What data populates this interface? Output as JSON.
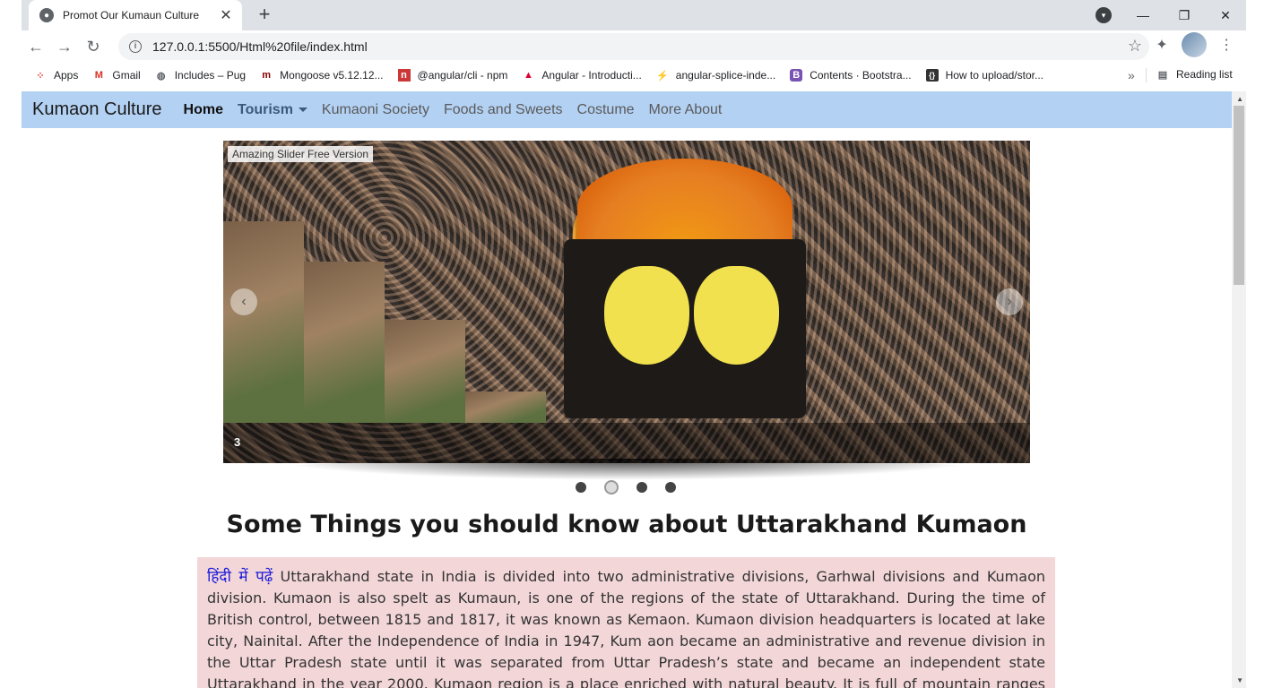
{
  "browser": {
    "tab_title": "Promot Our Kumaun Culture",
    "url": "127.0.0.1:5500/Html%20file/index.html",
    "bookmarks": [
      {
        "label": "Apps"
      },
      {
        "label": "Gmail"
      },
      {
        "label": "Includes – Pug"
      },
      {
        "label": "Mongoose v5.12.12..."
      },
      {
        "label": "@angular/cli - npm"
      },
      {
        "label": "Angular - Introducti..."
      },
      {
        "label": "angular-splice-inde..."
      },
      {
        "label": "Contents · Bootstra..."
      },
      {
        "label": "How to upload/stor..."
      }
    ],
    "more_bookmarks": "»",
    "reading_list": "Reading list"
  },
  "nav": {
    "brand": "Kumaon Culture",
    "links": [
      "Home",
      "Tourism",
      "Kumaoni Society",
      "Foods and Sweets",
      "Costume",
      "More About"
    ]
  },
  "slider": {
    "badge": "Amazing Slider Free Version",
    "caption": "3",
    "dots_count": 4,
    "active_dot": 2
  },
  "heading": "Some Things you should know about Uttarakhand Kumaon",
  "content": {
    "hindi_link": "हिंदी में पढ़ें",
    "text": " Uttarakhand state in India is divided into two administrative divisions, Garhwal divisions and Kumaon division. Kumaon is also spelt as Kumaun, is one of the regions of the state of Uttarakhand. During the time of British control, between 1815 and 1817, it was known as Kemaon. Kumaon division headquarters is located at lake city, Nainital. After the Independence of India in 1947, Kum aon became an administrative and revenue division in the Uttar Pradesh state until it was separated from Uttar Pradesh’s state and became an independent state Uttarakhand in the year 2000. Kumaon region is a place enriched with natural beauty. It is full of mountain ranges and mountain peaks because of its scenic views and beautiful hilly surroundings with tall trees, and it is a place of"
  },
  "colors": {
    "nav_bg": "#b3d1f3",
    "content_bg": "#f3d6d8",
    "hindi_link": "#1a1adb"
  }
}
